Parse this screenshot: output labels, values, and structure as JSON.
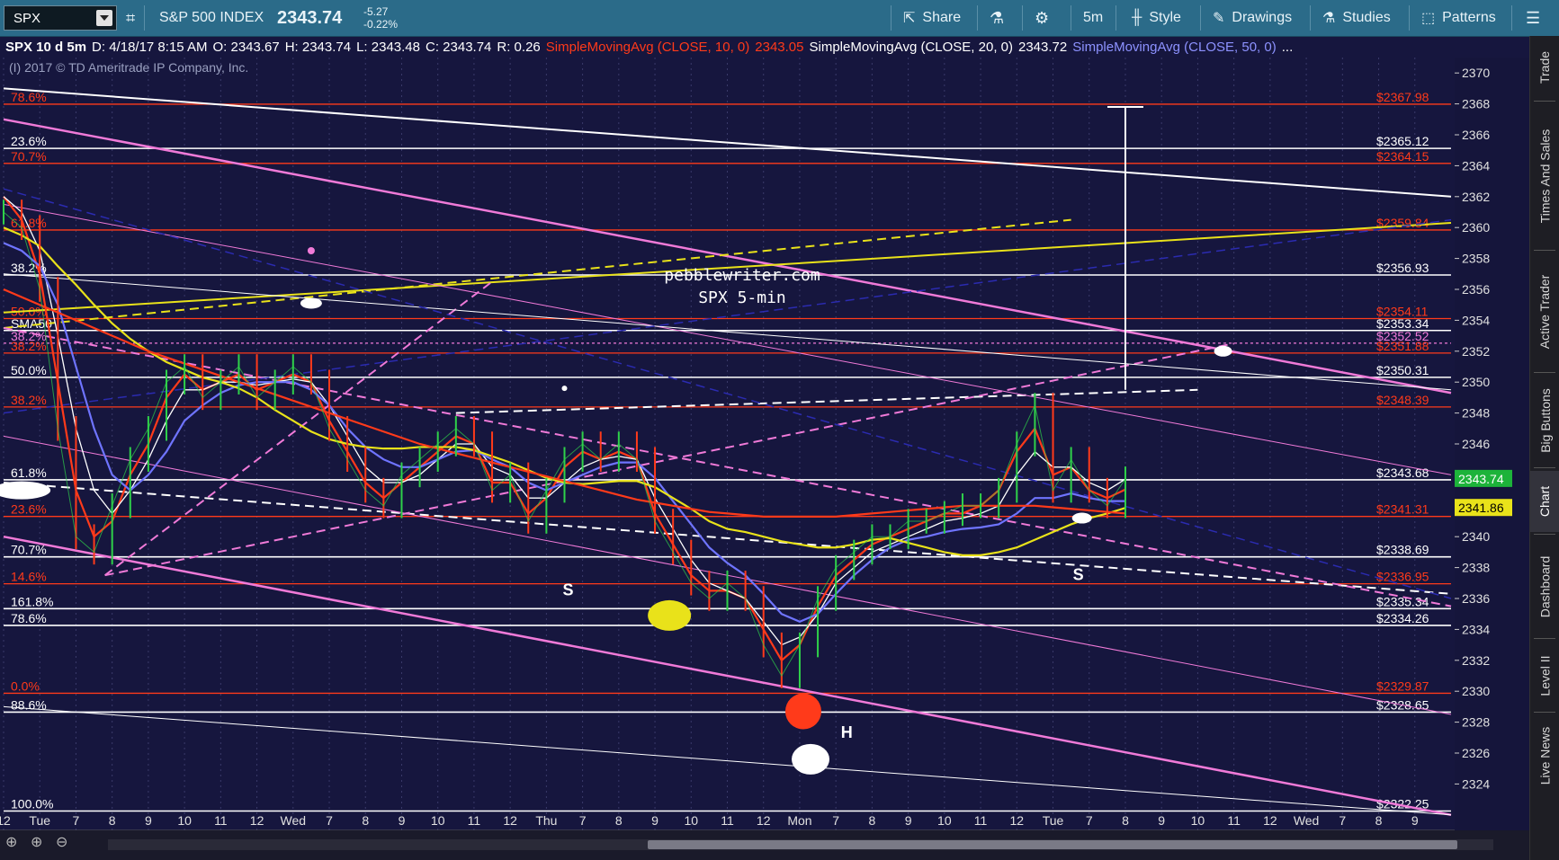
{
  "toolbar": {
    "symbol": "SPX",
    "index_name": "S&P 500 INDEX",
    "price": "2343.74",
    "change": "-5.27",
    "change_pct": "-0.22%",
    "share": "Share",
    "flask_icon": "flask-icon",
    "gear_icon": "gear-icon",
    "timeframe": "5m",
    "style": "Style",
    "drawings": "Drawings",
    "studies": "Studies",
    "patterns": "Patterns"
  },
  "infobar": {
    "label": "SPX 10 d 5m",
    "date": "D: 4/18/17 8:15 AM",
    "open": "O: 2343.67",
    "high": "H: 2343.74",
    "low": "L: 2343.48",
    "close": "C: 2343.74",
    "range": "R: 0.26",
    "sma10": "SimpleMovingAvg (CLOSE, 10, 0)",
    "sma10_val": "2343.05",
    "sma20": "SimpleMovingAvg (CLOSE, 20, 0)",
    "sma20_val": "2343.72",
    "sma50": "SimpleMovingAvg (CLOSE, 50, 0)",
    "more": "..."
  },
  "copyright": "(I) 2017 © TD Ameritrade IP Company, Inc.",
  "sidebar": [
    "Trade",
    "Times And Sales",
    "Active Trader",
    "Big Buttons",
    "Chart",
    "Dashboard",
    "Level II",
    "Live News"
  ],
  "colors": {
    "background": "#16163e",
    "white": "#ffffff",
    "red": "#ff3a1a",
    "yellow": "#e9e21a",
    "magenta": "#f07ad8",
    "blue": "#6f74ff",
    "price_tag": "#1db33a",
    "sma_tag": "#e9e21a"
  },
  "chart_data": {
    "type": "line",
    "title": "",
    "watermark": [
      "pebblewriter.com",
      "SPX 5-min"
    ],
    "ylim": [
      2321,
      2371
    ],
    "yticks": [
      2324,
      2326,
      2328,
      2330,
      2332,
      2334,
      2336,
      2338,
      2340,
      2342,
      2344,
      2346,
      2348,
      2350,
      2352,
      2354,
      2356,
      2358,
      2360,
      2362,
      2364,
      2366,
      2368,
      2370
    ],
    "xlabels": [
      "12",
      "Tue",
      "7",
      "8",
      "9",
      "10",
      "11",
      "12",
      "Wed",
      "7",
      "8",
      "9",
      "10",
      "11",
      "12",
      "Thu",
      "7",
      "8",
      "9",
      "10",
      "11",
      "12",
      "Mon",
      "7",
      "8",
      "9",
      "10",
      "11",
      "12",
      "Tue",
      "7",
      "8",
      "9",
      "10",
      "11",
      "12",
      "Wed",
      "7",
      "8",
      "9"
    ],
    "xlim": [
      0,
      40
    ],
    "last_price": "2343.74",
    "last_sma": "2341.86",
    "price": {
      "x": [
        0.0,
        0.5,
        1.0,
        1.5,
        2.0,
        2.5,
        3.0,
        3.5,
        4.0,
        4.5,
        5.0,
        5.5,
        6.0,
        6.5,
        7.0,
        7.5,
        8.0,
        8.5,
        9.0,
        9.5,
        10.0,
        10.5,
        11.0,
        11.5,
        12.0,
        12.5,
        13.0,
        13.5,
        14.0,
        14.5,
        15.0,
        15.5,
        16.0,
        16.5,
        17.0,
        17.5,
        18.0,
        18.5,
        19.0,
        19.5,
        20.0,
        20.5,
        21.0,
        21.5,
        22.0,
        22.5,
        23.0,
        23.5,
        24.0,
        24.5,
        25.0,
        25.5,
        26.0,
        26.5,
        27.0,
        27.5,
        28.0,
        28.5,
        29.0,
        29.5,
        30.0,
        30.5,
        31.0
      ],
      "y": [
        2361.0,
        2360.0,
        2356.0,
        2347.0,
        2340.0,
        2339.0,
        2342.0,
        2345.0,
        2347.0,
        2350.0,
        2351.0,
        2349.0,
        2350.0,
        2351.0,
        2349.0,
        2350.0,
        2351.0,
        2350.0,
        2347.0,
        2345.0,
        2343.0,
        2342.0,
        2344.0,
        2345.0,
        2346.0,
        2347.0,
        2346.0,
        2343.0,
        2344.0,
        2341.0,
        2343.0,
        2345.0,
        2346.0,
        2345.0,
        2346.0,
        2345.0,
        2341.0,
        2339.0,
        2337.0,
        2336.0,
        2337.0,
        2336.0,
        2333.0,
        2331.0,
        2333.0,
        2336.0,
        2338.0,
        2339.0,
        2340.0,
        2340.0,
        2341.0,
        2341.0,
        2341.5,
        2342.0,
        2342.0,
        2343.0,
        2346.0,
        2348.5,
        2343.0,
        2345.0,
        2343.0,
        2342.0,
        2343.74
      ]
    },
    "series": [
      {
        "name": "SimpleMovingAvg (CLOSE, 10, 0)",
        "color": "#ff3a1a",
        "values": [
          2362.0,
          2360.5,
          2357.0,
          2350.0,
          2343.0,
          2340.0,
          2341.0,
          2344.0,
          2346.0,
          2349.0,
          2350.5,
          2349.5,
          2350.0,
          2350.5,
          2349.5,
          2350.0,
          2350.5,
          2350.0,
          2347.5,
          2345.5,
          2343.5,
          2342.5,
          2343.5,
          2344.5,
          2345.5,
          2346.5,
          2346.0,
          2343.5,
          2343.5,
          2341.5,
          2342.5,
          2344.5,
          2345.5,
          2345.0,
          2345.5,
          2345.0,
          2341.5,
          2339.5,
          2337.5,
          2336.5,
          2336.5,
          2336.0,
          2334.0,
          2332.0,
          2333.0,
          2335.5,
          2337.5,
          2338.5,
          2339.5,
          2340.0,
          2340.5,
          2341.0,
          2341.5,
          2341.5,
          2342.0,
          2343.0,
          2345.5,
          2347.0,
          2344.0,
          2344.5,
          2343.0,
          2342.5,
          2343.05
        ]
      },
      {
        "name": "SimpleMovingAvg (CLOSE, 20, 0)",
        "color": "#ffffff",
        "values": [
          2362.0,
          2361.0,
          2358.5,
          2353.0,
          2347.0,
          2343.0,
          2341.5,
          2343.0,
          2345.0,
          2347.5,
          2349.5,
          2349.5,
          2350.0,
          2350.0,
          2349.8,
          2350.0,
          2350.2,
          2350.0,
          2348.5,
          2346.5,
          2344.5,
          2343.5,
          2343.5,
          2344.0,
          2345.0,
          2346.0,
          2346.0,
          2344.5,
          2344.0,
          2342.5,
          2342.5,
          2343.5,
          2344.5,
          2345.0,
          2345.2,
          2345.0,
          2342.5,
          2340.5,
          2338.5,
          2337.0,
          2336.5,
          2336.0,
          2334.5,
          2333.0,
          2333.5,
          2335.0,
          2337.0,
          2338.0,
          2339.0,
          2339.5,
          2340.0,
          2340.5,
          2341.0,
          2341.2,
          2341.5,
          2342.0,
          2344.0,
          2345.5,
          2344.5,
          2344.5,
          2343.5,
          2343.0,
          2343.72
        ]
      },
      {
        "name": "SimpleMovingAvg (CLOSE, 50, 0)",
        "color": "#6f74ff",
        "values": [
          2359.0,
          2358.5,
          2357.5,
          2355.0,
          2351.0,
          2347.0,
          2344.0,
          2343.0,
          2344.0,
          2345.5,
          2347.5,
          2348.5,
          2349.3,
          2349.8,
          2350.0,
          2350.0,
          2350.0,
          2349.5,
          2348.5,
          2347.0,
          2345.8,
          2345.0,
          2344.5,
          2344.5,
          2345.0,
          2345.5,
          2345.6,
          2345.0,
          2344.5,
          2343.5,
          2343.0,
          2343.5,
          2344.0,
          2344.5,
          2344.8,
          2344.8,
          2343.8,
          2342.3,
          2340.8,
          2339.3,
          2338.3,
          2337.5,
          2336.3,
          2335.0,
          2334.5,
          2335.0,
          2336.3,
          2337.5,
          2338.5,
          2339.3,
          2339.8,
          2340.0,
          2340.3,
          2340.5,
          2340.6,
          2340.8,
          2341.5,
          2342.5,
          2342.5,
          2342.8,
          2342.5,
          2342.3,
          2342.3
        ]
      },
      {
        "name": "",
        "color": "#e9e21a",
        "values": [
          2360.0,
          2359.5,
          2358.8,
          2357.5,
          2356.3,
          2355.0,
          2353.8,
          2352.8,
          2352.0,
          2351.3,
          2350.8,
          2350.3,
          2350.0,
          2349.6,
          2349.0,
          2348.2,
          2347.5,
          2346.8,
          2346.3,
          2346.0,
          2345.8,
          2345.7,
          2345.7,
          2345.8,
          2345.8,
          2345.8,
          2345.6,
          2345.2,
          2344.8,
          2344.3,
          2343.8,
          2343.5,
          2343.4,
          2343.5,
          2343.6,
          2343.6,
          2343.2,
          2342.5,
          2341.8,
          2341.0,
          2340.5,
          2340.3,
          2340.0,
          2339.7,
          2339.5,
          2339.3,
          2339.3,
          2339.5,
          2339.8,
          2339.9,
          2339.6,
          2339.3,
          2339.0,
          2338.8,
          2338.8,
          2339.0,
          2339.3,
          2339.8,
          2340.3,
          2340.8,
          2341.2,
          2341.5,
          2341.86
        ]
      },
      {
        "name": "",
        "color": "#ff3a1a",
        "values": [
          2356.0,
          2355.5,
          2355.0,
          2354.5,
          2354.0,
          2353.5,
          2353.0,
          2352.5,
          2352.0,
          2351.6,
          2351.2,
          2350.8,
          2350.4,
          2350.0,
          2349.6,
          2349.2,
          2348.8,
          2348.4,
          2348.0,
          2347.6,
          2347.2,
          2346.8,
          2346.4,
          2346.0,
          2345.7,
          2345.4,
          2345.1,
          2344.8,
          2344.5,
          2344.2,
          2343.9,
          2343.6,
          2343.3,
          2343.0,
          2342.7,
          2342.4,
          2342.2,
          2342.0,
          2341.8,
          2341.6,
          2341.5,
          2341.4,
          2341.3,
          2341.3,
          2341.3,
          2341.3,
          2341.3,
          2341.4,
          2341.5,
          2341.6,
          2341.7,
          2341.8,
          2341.9,
          2342.0,
          2342.0,
          2342.0,
          2342.0,
          2342.0,
          2341.9,
          2341.8,
          2341.7,
          2341.6,
          2341.5
        ]
      }
    ],
    "fib_levels": [
      {
        "pct": "78.6%",
        "price": "$2367.98",
        "y": 2367.98,
        "color": "#ff3a1a"
      },
      {
        "pct": "23.6%",
        "price": "$2365.12",
        "y": 2365.12,
        "color": "#ffffff"
      },
      {
        "pct": "70.7%",
        "price": "$2364.15",
        "y": 2364.15,
        "color": "#ff3a1a"
      },
      {
        "pct": "61.8%",
        "price": "$2359.84",
        "y": 2359.84,
        "color": "#ff3a1a"
      },
      {
        "pct": "38.2%",
        "price": "$2356.93",
        "y": 2356.93,
        "color": "#ffffff"
      },
      {
        "pct": "50.0%",
        "price": "$2354.11",
        "y": 2354.11,
        "color": "#ff3a1a"
      },
      {
        "pct": "SMA50",
        "price": "$2353.34",
        "y": 2353.34,
        "color": "#ffffff"
      },
      {
        "pct": "38.2%",
        "price": "$2352.52",
        "y": 2352.52,
        "color": "#f07ad8"
      },
      {
        "pct": "38.2%",
        "price": "$2351.88",
        "y": 2351.88,
        "color": "#ff3a1a"
      },
      {
        "pct": "50.0%",
        "price": "$2350.31",
        "y": 2350.31,
        "color": "#ffffff"
      },
      {
        "pct": "38.2%",
        "price": "$2348.39",
        "y": 2348.39,
        "color": "#ff3a1a"
      },
      {
        "pct": "61.8%",
        "price": "$2343.68",
        "y": 2343.68,
        "color": "#ffffff"
      },
      {
        "pct": "23.6%",
        "price": "$2341.31",
        "y": 2341.31,
        "color": "#ff3a1a"
      },
      {
        "pct": "70.7%",
        "price": "$2338.69",
        "y": 2338.69,
        "color": "#ffffff"
      },
      {
        "pct": "14.6%",
        "price": "$2336.95",
        "y": 2336.95,
        "color": "#ff3a1a"
      },
      {
        "pct": "161.8%",
        "price": "$2335.34",
        "y": 2335.34,
        "color": "#ffffff"
      },
      {
        "pct": "78.6%",
        "price": "$2334.26",
        "y": 2334.26,
        "color": "#ffffff"
      },
      {
        "pct": "0.0%",
        "price": "$2329.87",
        "y": 2329.87,
        "color": "#ff3a1a"
      },
      {
        "pct": "88.6%",
        "price": "$2328.65",
        "y": 2328.65,
        "color": "#ffffff"
      },
      {
        "pct": "100.0%",
        "price": "$2322.25",
        "y": 2322.25,
        "color": "#ffffff"
      }
    ],
    "trendlines": [
      {
        "color": "#ffffff",
        "dash": false,
        "width": 2,
        "x1": 0,
        "y1": 2369.0,
        "x2": 40,
        "y2": 2362.0
      },
      {
        "color": "#f07ad8",
        "dash": false,
        "width": 2.5,
        "x1": 0,
        "y1": 2367.0,
        "x2": 40,
        "y2": 2349.3
      },
      {
        "color": "#f07ad8",
        "dash": false,
        "width": 2.5,
        "x1": 0,
        "y1": 2340.0,
        "x2": 40,
        "y2": 2322.0
      },
      {
        "color": "#e9e21a",
        "dash": false,
        "width": 2,
        "x1": 0,
        "y1": 2354.5,
        "x2": 40,
        "y2": 2360.3
      },
      {
        "color": "#e9e21a",
        "dash": true,
        "width": 2,
        "x1": 0,
        "y1": 2353.5,
        "x2": 29.5,
        "y2": 2360.5
      },
      {
        "color": "#ffffff",
        "dash": true,
        "width": 2,
        "x1": 0,
        "y1": 2343.5,
        "x2": 40,
        "y2": 2336.3
      },
      {
        "color": "#ffffff",
        "dash": true,
        "width": 2,
        "x1": 12.5,
        "y1": 2348.0,
        "x2": 33,
        "y2": 2349.5
      },
      {
        "color": "#f07ad8",
        "dash": true,
        "width": 2,
        "x1": 2.8,
        "y1": 2337.5,
        "x2": 13.5,
        "y2": 2356.5
      },
      {
        "color": "#f07ad8",
        "dash": true,
        "width": 2,
        "x1": 2.8,
        "y1": 2337.5,
        "x2": 34,
        "y2": 2352.5
      },
      {
        "color": "#f07ad8",
        "dash": true,
        "width": 2,
        "x1": 0,
        "y1": 2353.5,
        "x2": 40,
        "y2": 2335.5
      },
      {
        "color": "#f07ad8",
        "dash": false,
        "width": 1,
        "x1": 0,
        "y1": 2361.5,
        "x2": 40,
        "y2": 2344.0
      },
      {
        "color": "#f07ad8",
        "dash": false,
        "width": 1,
        "x1": 0,
        "y1": 2346.5,
        "x2": 40,
        "y2": 2328.5
      },
      {
        "color": "#ffffff",
        "dash": false,
        "width": 1,
        "x1": 0,
        "y1": 2357.0,
        "x2": 40,
        "y2": 2349.5
      },
      {
        "color": "#ffffff",
        "dash": false,
        "width": 1,
        "x1": 0,
        "y1": 2329.0,
        "x2": 40,
        "y2": 2322.0
      },
      {
        "color": "#2b2bb0",
        "dash": true,
        "width": 1.5,
        "x1": 0,
        "y1": 2348.0,
        "x2": 40,
        "y2": 2360.5
      },
      {
        "color": "#2b2bb0",
        "dash": true,
        "width": 1.5,
        "x1": 0,
        "y1": 2362.5,
        "x2": 40,
        "y2": 2336.0
      }
    ],
    "target_bar": {
      "x": 31,
      "y_top": 2367.8,
      "y_bottom": 2349.5
    },
    "markers": [
      {
        "shape": "ellipse",
        "color": "#e9e21a",
        "x": 18.4,
        "y": 2334.9,
        "rx": 24,
        "ry": 17
      },
      {
        "shape": "ellipse",
        "color": "#ff3a1a",
        "x": 22.1,
        "y": 2328.7,
        "rx": 20,
        "ry": 20
      },
      {
        "shape": "ellipse",
        "color": "#ffffff",
        "x": 22.3,
        "y": 2325.6,
        "rx": 21,
        "ry": 17
      },
      {
        "shape": "ellipse",
        "color": "#ffffff",
        "x": 0.5,
        "y": 2343.0,
        "rx": 32,
        "ry": 10
      },
      {
        "shape": "ellipse",
        "color": "#ffffff",
        "x": 8.5,
        "y": 2355.1,
        "rx": 12,
        "ry": 6
      },
      {
        "shape": "ellipse",
        "color": "#ffffff",
        "x": 33.7,
        "y": 2352.0,
        "rx": 10,
        "ry": 6
      },
      {
        "shape": "ellipse",
        "color": "#ffffff",
        "x": 29.8,
        "y": 2341.2,
        "rx": 11,
        "ry": 6
      },
      {
        "shape": "ellipse",
        "color": "#f07ad8",
        "x": 8.5,
        "y": 2358.5,
        "rx": 4,
        "ry": 4
      },
      {
        "shape": "ellipse",
        "color": "#ffffff",
        "x": 15.5,
        "y": 2349.6,
        "rx": 3,
        "ry": 3
      }
    ],
    "pattern_labels": [
      {
        "text": "S",
        "x": 15.6,
        "y": 2336.2
      },
      {
        "text": "S",
        "x": 29.7,
        "y": 2337.2
      },
      {
        "text": "H",
        "x": 23.3,
        "y": 2327.0
      }
    ]
  }
}
